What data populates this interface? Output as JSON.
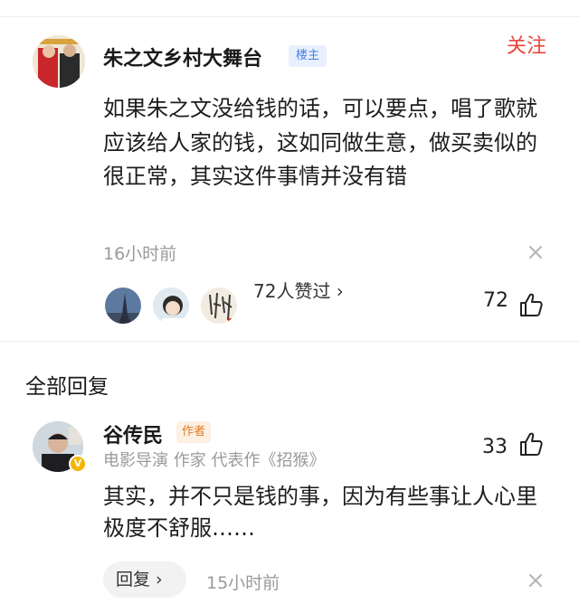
{
  "post": {
    "author_name": "朱之文乡村大舞台",
    "author_badge": "楼主",
    "follow_label": "关注",
    "body": "如果朱之文没给钱的话，可以要点，唱了歌就应该给人家的钱，这如同做生意，做买卖似的很正常，其实这件事情并没有错",
    "time": "16小时前",
    "liked_text": "72人赞过 ›",
    "like_count": "72",
    "liker_avatars": [
      "eiffel-tower-avatar",
      "girl-avatar",
      "calligraphy-avatar"
    ]
  },
  "replies_section": {
    "title": "全部回复"
  },
  "reply": {
    "author_name": "谷传民",
    "author_badge": "作者",
    "bio": "电影导演 作家 代表作《招猴》",
    "like_count": "33",
    "body": "其实，并不只是钱的事，因为有些事让人心里极度不舒服……",
    "reply_button": "回复 ›",
    "time": "15小时前"
  },
  "colors": {
    "follow": "#e8453c",
    "owner_badge": "#4a7fe0",
    "author_badge": "#e07a22",
    "verified": "#f4b400",
    "muted_text": "#9a9a9a"
  }
}
